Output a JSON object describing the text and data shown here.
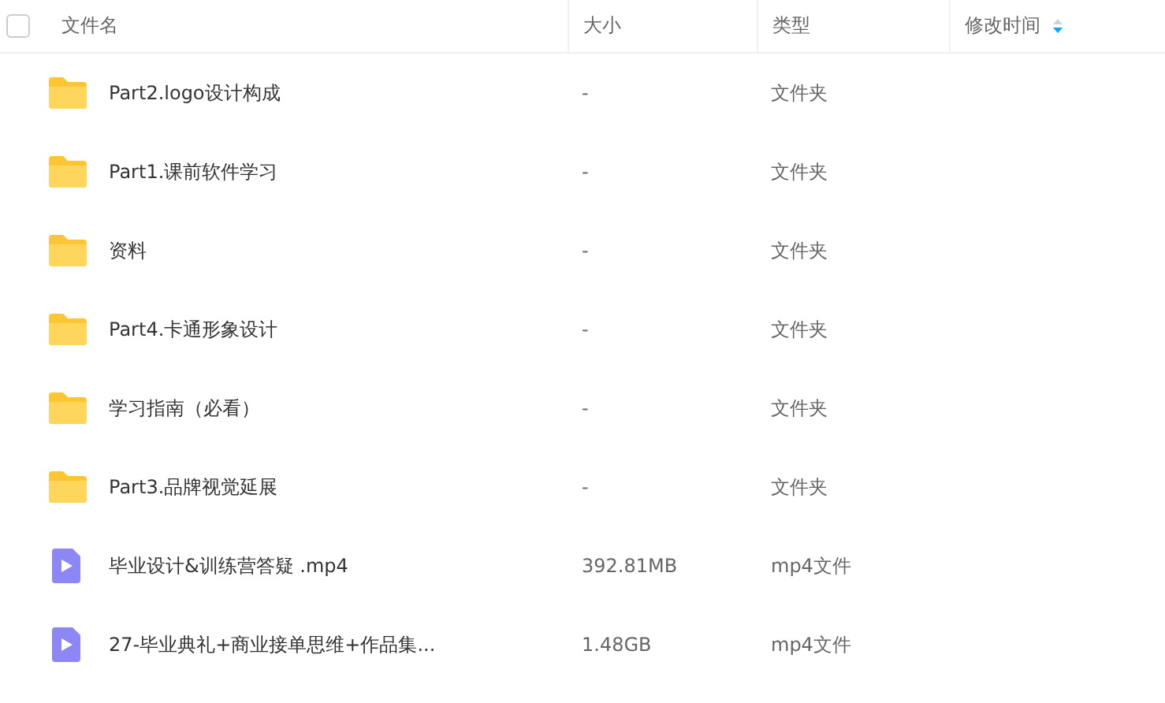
{
  "table": {
    "select_all": {
      "checked": false
    },
    "columns": [
      {
        "label": "文件名"
      },
      {
        "label": "大小"
      },
      {
        "label": "类型"
      },
      {
        "label": "修改时间",
        "sortable": true
      }
    ],
    "rows": [
      {
        "kind": "folder",
        "name": "Part2.logo设计构成",
        "size": "-",
        "type": "文件夹"
      },
      {
        "kind": "folder",
        "name": "Part1.课前软件学习",
        "size": "-",
        "type": "文件夹"
      },
      {
        "kind": "folder",
        "name": "资料",
        "size": "-",
        "type": "文件夹"
      },
      {
        "kind": "folder",
        "name": "Part4.卡通形象设计",
        "size": "-",
        "type": "文件夹"
      },
      {
        "kind": "folder",
        "name": "学习指南（必看）",
        "size": "-",
        "type": "文件夹"
      },
      {
        "kind": "folder",
        "name": "Part3.品牌视觉延展",
        "size": "-",
        "type": "文件夹"
      },
      {
        "kind": "video",
        "name": "毕业设计&训练营答疑 .mp4",
        "size": "392.81MB",
        "type": "mp4文件"
      },
      {
        "kind": "video",
        "name": "27-毕业典礼+商业接单思维+作品集...",
        "size": "1.48GB",
        "type": "mp4文件"
      }
    ]
  }
}
